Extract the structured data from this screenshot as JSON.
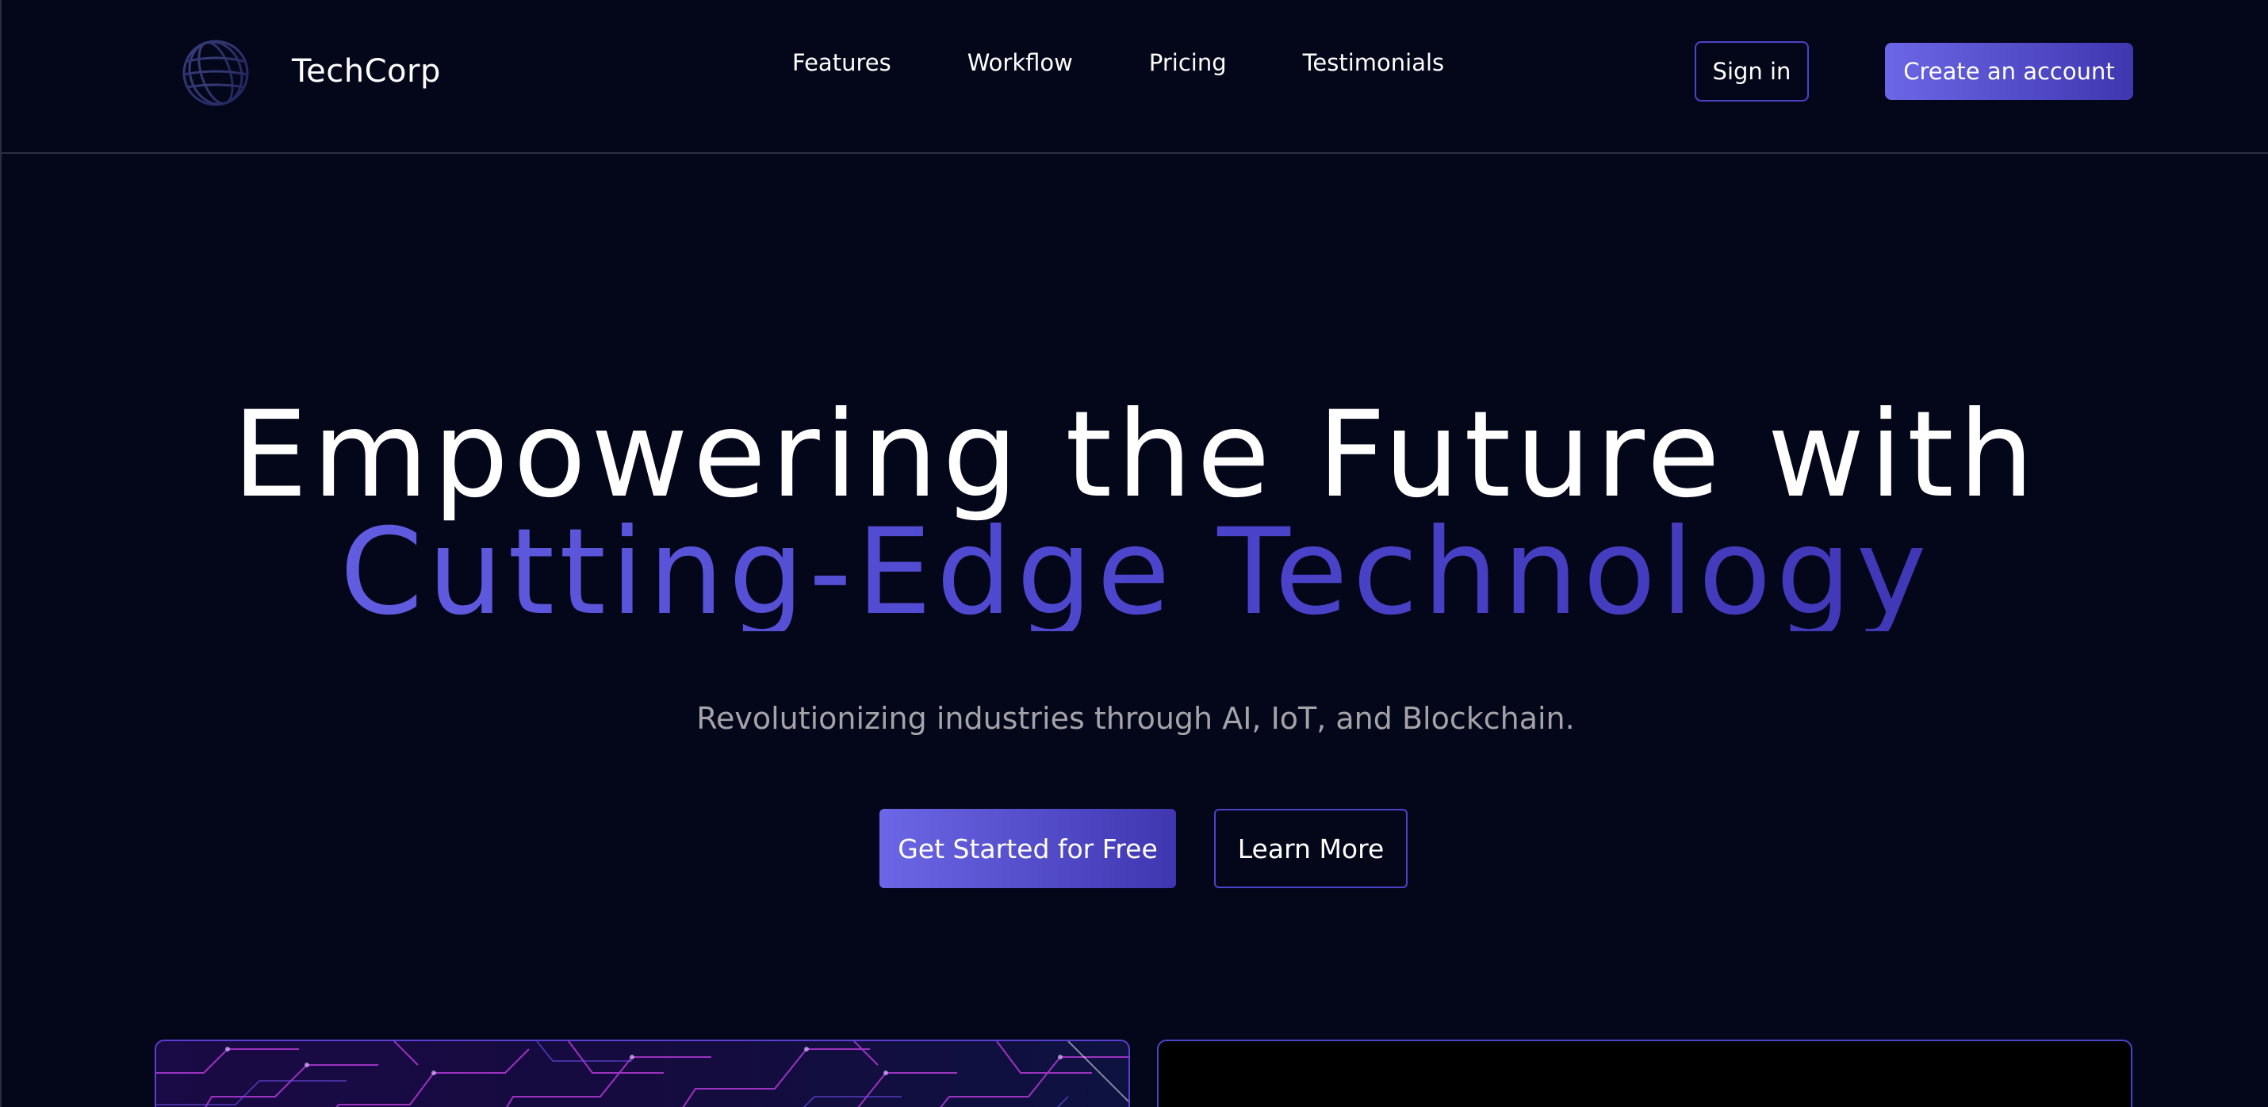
{
  "header": {
    "brand_name": "TechCorp",
    "logo_icon": "globe-icon",
    "nav_links": [
      "Features",
      "Workflow",
      "Pricing",
      "Testimonials"
    ],
    "signin_label": "Sign in",
    "create_account_label": "Create an account"
  },
  "hero": {
    "title_line1": "Empowering the Future with",
    "title_line2": "Cutting-Edge Technology",
    "subtitle": "Revolutionizing industries through AI, IoT, and Blockchain.",
    "primary_cta": "Get Started for Free",
    "secondary_cta": "Learn More"
  },
  "colors": {
    "background": "#04061a",
    "accent_start": "#6c67e6",
    "accent_end": "#3f36b0",
    "subtitle_text": "#a3a3a8"
  }
}
